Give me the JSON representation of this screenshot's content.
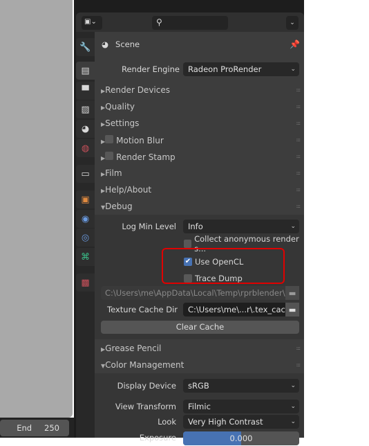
{
  "timeline": {
    "end_label": "End",
    "end_value": "250"
  },
  "header": {
    "search_placeholder": ""
  },
  "context": {
    "title": "Scene"
  },
  "render_engine": {
    "label": "Render Engine",
    "value": "Radeon ProRender"
  },
  "panels": [
    {
      "title": "Render Devices",
      "checkbox": false
    },
    {
      "title": "Quality",
      "checkbox": false
    },
    {
      "title": "Settings",
      "checkbox": false
    },
    {
      "title": "Motion Blur",
      "checkbox": true
    },
    {
      "title": "Render Stamp",
      "checkbox": true
    },
    {
      "title": "Film",
      "checkbox": false
    },
    {
      "title": "Help/About",
      "checkbox": false
    }
  ],
  "debug": {
    "title": "Debug",
    "log_label": "Log Min Level",
    "log_value": "Info",
    "collect_label": "Collect anonymous render s...",
    "collect_checked": false,
    "opencl_label": "Use OpenCL",
    "opencl_checked": true,
    "trace_label": "Trace Dump",
    "trace_checked": false,
    "trace_path": "C:\\Users\\me\\AppData\\Local\\Temp\\rprblender\\trac...",
    "tex_label": "Texture Cache Dir",
    "tex_value": "C:\\Users\\me\\...r\\.tex_cache",
    "clear_label": "Clear Cache"
  },
  "grease_pencil": {
    "title": "Grease Pencil"
  },
  "color_management": {
    "title": "Color Management",
    "display_label": "Display Device",
    "display_value": "sRGB",
    "view_label": "View Transform",
    "view_value": "Filmic",
    "look_label": "Look",
    "look_value": "Very High Contrast",
    "exposure_label": "Exposure",
    "exposure_value": "0.000"
  },
  "colors": {
    "highlight": "#e00000",
    "accent": "#4772b3"
  }
}
